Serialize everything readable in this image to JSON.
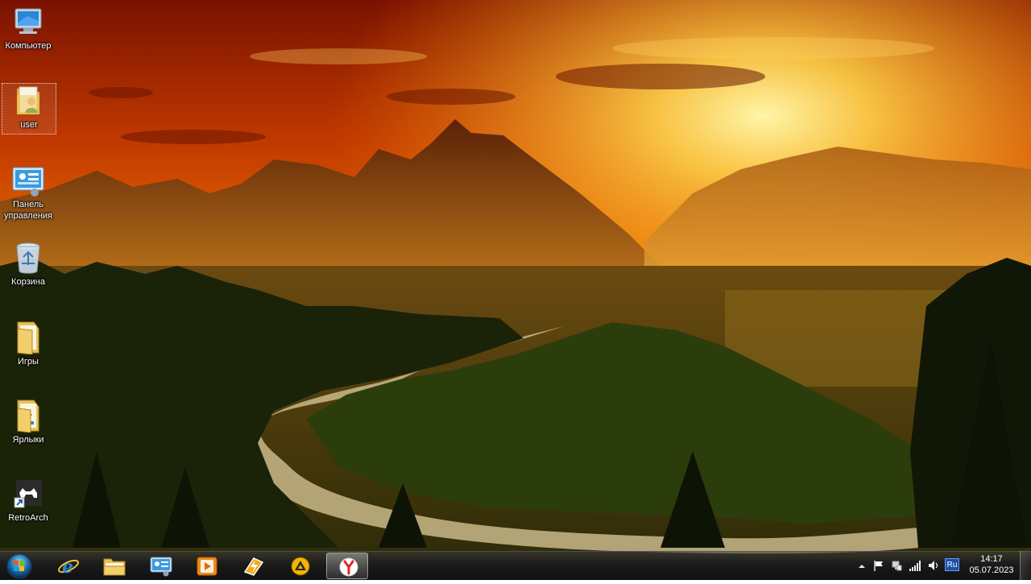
{
  "desktop": {
    "icons": [
      {
        "label": "Компьютер",
        "icon": "computer-icon"
      },
      {
        "label": "user",
        "icon": "user-folder-icon"
      },
      {
        "label": "Панель управления",
        "icon": "control-panel-icon"
      },
      {
        "label": "Корзина",
        "icon": "recycle-bin-icon"
      },
      {
        "label": "Игры",
        "icon": "folder-icon"
      },
      {
        "label": "Ярлыки",
        "icon": "shortcuts-folder-icon"
      },
      {
        "label": "RetroArch",
        "icon": "retroarch-icon"
      }
    ]
  },
  "taskbar": {
    "pinned": [
      {
        "name": "internet-explorer",
        "icon": "internet-explorer-icon"
      },
      {
        "name": "file-explorer",
        "icon": "folder-icon"
      },
      {
        "name": "control-panel",
        "icon": "control-panel-icon"
      },
      {
        "name": "media-player",
        "icon": "media-player-icon"
      },
      {
        "name": "lightning-app",
        "icon": "lightning-icon"
      },
      {
        "name": "aimp",
        "icon": "aimp-icon"
      },
      {
        "name": "yandex-browser",
        "icon": "yandex-icon",
        "active": true
      }
    ],
    "tray": {
      "language": "Ru",
      "time": "14:17",
      "date": "05.07.2023",
      "icons": [
        "chevron-up-icon",
        "flag-icon",
        "network-icon",
        "signal-icon",
        "speaker-icon"
      ]
    }
  },
  "colors": {
    "sky_top": "#8a1a00",
    "sky_glow": "#ffcf3a",
    "taskbar": "#1a1d26",
    "language_badge": "#1d4fa8"
  }
}
